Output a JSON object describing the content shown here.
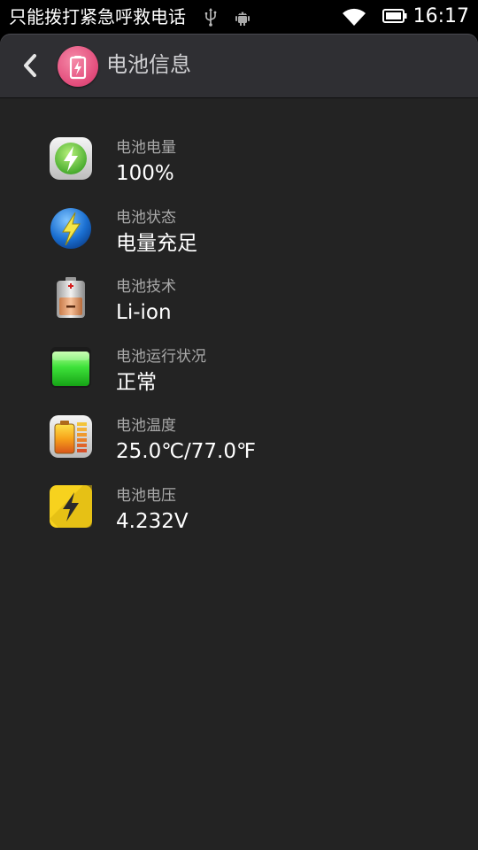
{
  "status_bar": {
    "carrier_text": "只能拨打紧急呼救电话",
    "time": "16:17",
    "icons": [
      "usb-icon",
      "debug-icon",
      "wifi-icon",
      "battery-icon"
    ]
  },
  "app_bar": {
    "title": "电池信息",
    "back_icon": "back-arrow-icon",
    "app_icon": "battery-app-icon",
    "accent_color": "#e24a7a"
  },
  "battery_info": {
    "items": [
      {
        "label": "电池电量",
        "value": "100%",
        "icon": "battery-level-icon"
      },
      {
        "label": "电池状态",
        "value": "电量充足",
        "icon": "battery-status-icon"
      },
      {
        "label": "电池技术",
        "value": "Li-ion",
        "icon": "battery-technology-icon"
      },
      {
        "label": "电池运行状况",
        "value": "正常",
        "icon": "battery-health-icon"
      },
      {
        "label": "电池温度",
        "value": "25.0℃/77.0℉",
        "icon": "battery-temperature-icon"
      },
      {
        "label": "电池电压",
        "value": "4.232V",
        "icon": "battery-voltage-icon"
      }
    ]
  },
  "colors": {
    "background": "#232323",
    "app_bar": "#2f2f33",
    "label": "#a9a9a9",
    "value": "#ffffff"
  }
}
